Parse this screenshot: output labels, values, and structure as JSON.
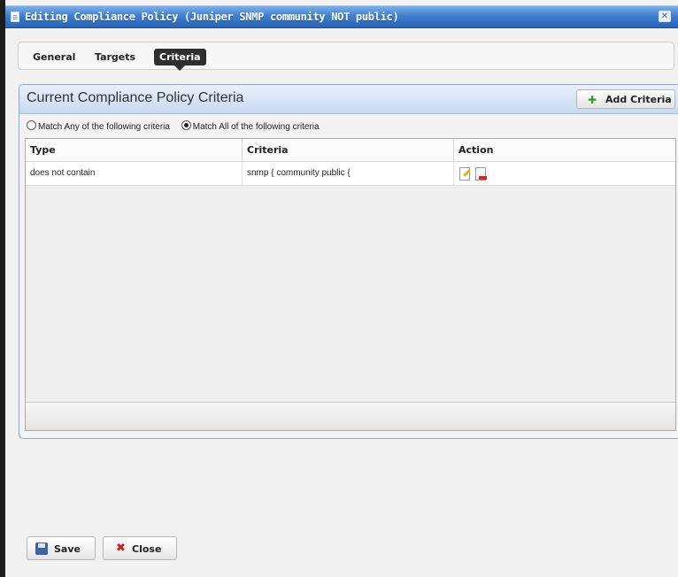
{
  "window": {
    "title": "Editing Compliance Policy (Juniper SNMP community NOT public)",
    "close_glyph": "✕"
  },
  "tabs": [
    {
      "label": "General"
    },
    {
      "label": "Targets"
    },
    {
      "label": "Criteria",
      "active": true
    }
  ],
  "panel": {
    "title": "Current Compliance Policy Criteria",
    "add_button": {
      "label": "Add Criteria",
      "icon": "plus-icon",
      "icon_glyph": "✚"
    }
  },
  "match": {
    "options": [
      {
        "label": "Match Any of the following criteria",
        "selected": false
      },
      {
        "label": "Match All of the following criteria",
        "selected": true
      }
    ]
  },
  "table": {
    "columns": [
      "Type",
      "Criteria",
      "Action"
    ],
    "rows": [
      {
        "type": "does not contain",
        "criteria": "snmp { community public {",
        "actions": [
          "edit-icon",
          "delete-icon"
        ]
      }
    ]
  },
  "footer": {
    "save_label": "Save",
    "close_label": "Close",
    "close_glyph": "✖"
  },
  "colors": {
    "titlebar": "#3f7fd0",
    "panel_header": "#c7d9f1",
    "active_tab": "#2f2f2f",
    "add_icon": "#3a9a2a",
    "close_icon": "#c52020"
  }
}
